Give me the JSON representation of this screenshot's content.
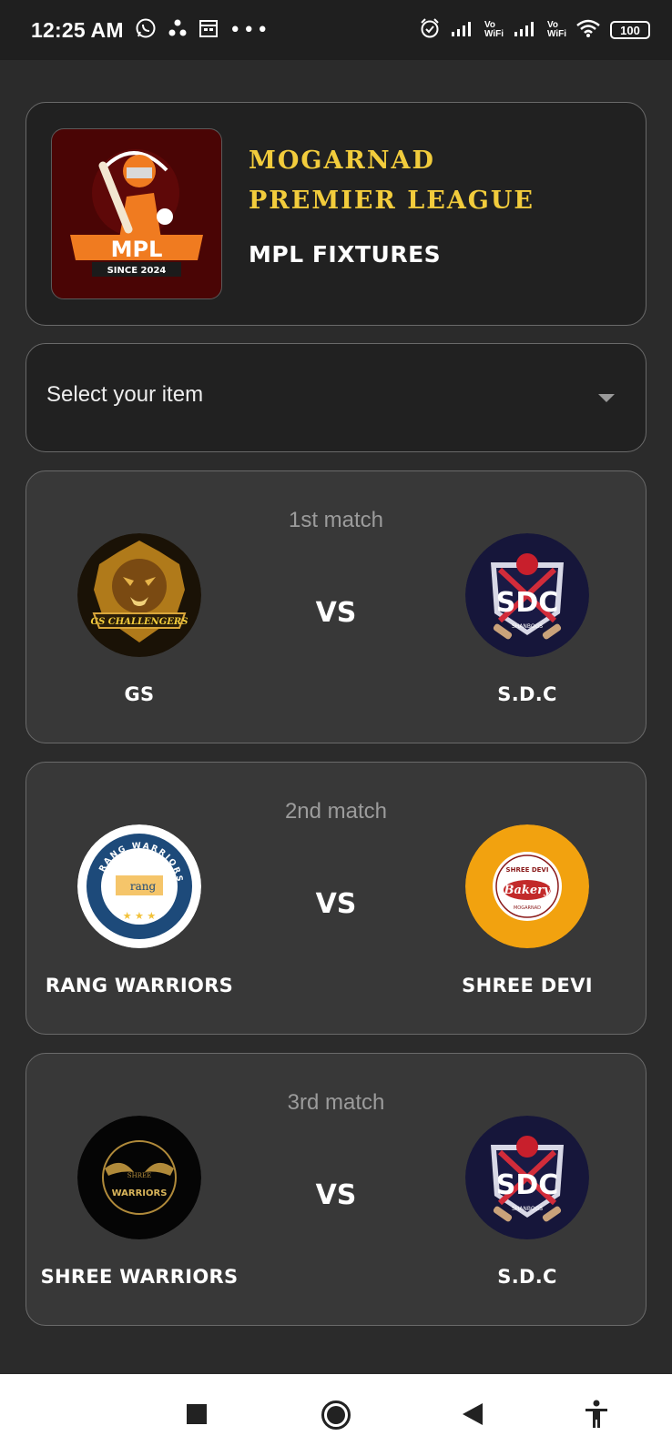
{
  "status_bar": {
    "time": "12:25 AM",
    "battery": "100",
    "vowifi_1": [
      "Vo",
      "WiFi"
    ],
    "vowifi_2": [
      "Vo",
      "WiFi"
    ],
    "notification_icons": [
      "whatsapp-icon",
      "share-icon",
      "calendar-icon",
      "more-dots-icon"
    ],
    "system_icons": [
      "alarm-icon",
      "signal-icon",
      "signal-icon",
      "wifi-icon",
      "battery-icon"
    ]
  },
  "header": {
    "logo_text": "MPL",
    "logo_since": "SINCE 2024",
    "title_line1": "Mogarnad",
    "title_line2": "Premier League",
    "subtitle": "MPL FIXTURES"
  },
  "select": {
    "label": "Select your item"
  },
  "matches": [
    {
      "label": "1st match",
      "vs": "VS",
      "team_left": {
        "name": "GS",
        "logo_text": "GS CHALLENGERS"
      },
      "team_right": {
        "name": "S.D.C",
        "logo_text": "SDC",
        "logo_subtext": "SHANBOGS"
      }
    },
    {
      "label": "2nd match",
      "vs": "VS",
      "team_left": {
        "name": "RANG WARRIORS",
        "logo_text": "RANG WARRIORS",
        "logo_subtext": "rang"
      },
      "team_right": {
        "name": "SHREE DEVI",
        "logo_text": "SHREE DEVI",
        "logo_subtext": "Bakery",
        "logo_subtext2": "MOGARNAD"
      }
    },
    {
      "label": "3rd match",
      "vs": "VS",
      "team_left": {
        "name": "SHREE WARRIORS",
        "logo_text": "WARRIORS",
        "logo_subtext": "SHREE"
      },
      "team_right": {
        "name": "S.D.C",
        "logo_text": "SDC",
        "logo_subtext": "SHANBOGS"
      }
    }
  ],
  "nav": {
    "buttons": [
      "recents-square-icon",
      "home-circle-icon",
      "back-triangle-icon",
      "accessibility-icon"
    ]
  },
  "colors": {
    "background": "#2b2b2b",
    "card_dark": "#212121",
    "match_card": "#383838",
    "title_gold": "#f2cc3c",
    "logo_bg": "#4a0505",
    "accent_orange": "#f07b20",
    "sdc_navy": "#16163a",
    "rang_blue": "#1d4a7a",
    "shree_devi_yellow": "#f2a20f"
  }
}
